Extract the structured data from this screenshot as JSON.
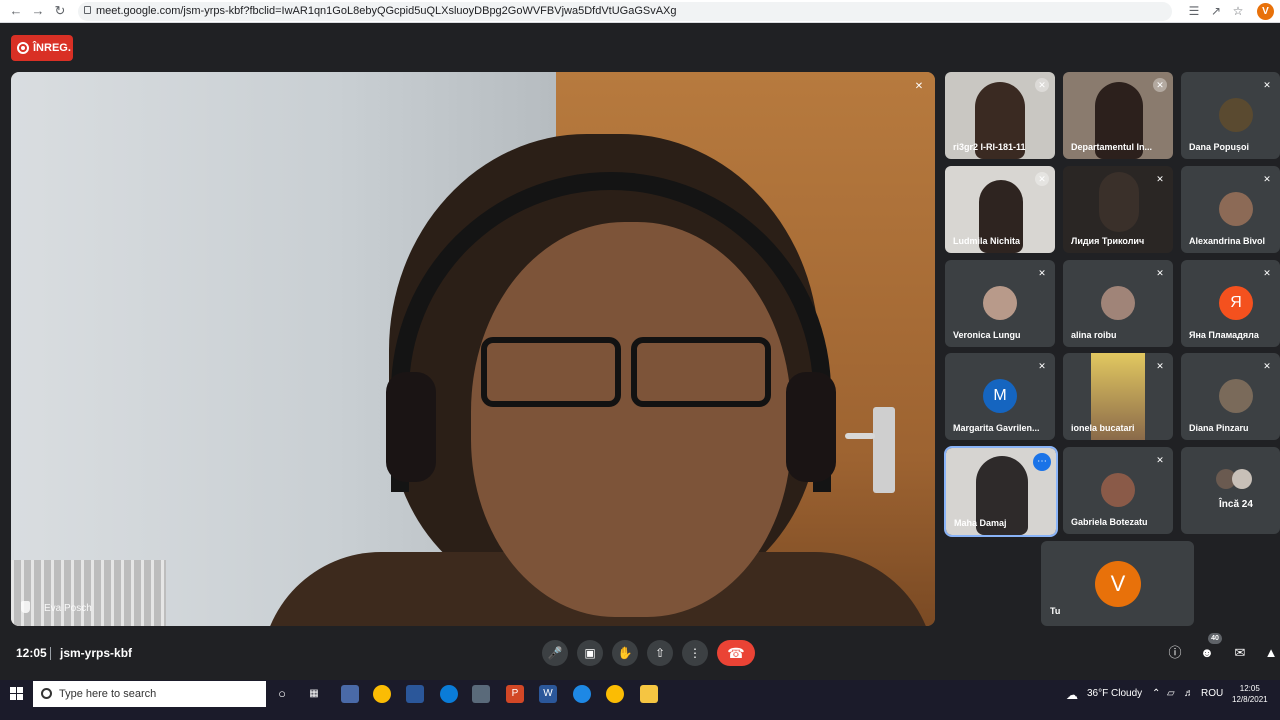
{
  "browser": {
    "url": "meet.google.com/jsm-yrps-kbf?fbclid=IwAR1qn1GoL8ebyQGcpid5uQLXsluoyDBpg2GoWVFBVjwa5DfdVtUGaGSvAXg",
    "profile_initial": "V"
  },
  "meeting": {
    "record_label": "ÎNREG.",
    "main_speaker": "Eva Posch",
    "time": "12:05",
    "code": "jsm-yrps-kbf",
    "participant_count": "40"
  },
  "tiles": [
    {
      "name": "ri3gr2 I-RI-181-11"
    },
    {
      "name": "Departamentul In..."
    },
    {
      "name": "Dana Popușoi"
    },
    {
      "name": "Ludmila Nichita"
    },
    {
      "name": "Лидия Триколич"
    },
    {
      "name": "Alexandrina Bivol"
    },
    {
      "name": "Veronica Lungu"
    },
    {
      "name": "alina roibu"
    },
    {
      "name": "Яна Пламадяла",
      "initial": "Я"
    },
    {
      "name": "Margarita Gavrilen...",
      "initial": "M"
    },
    {
      "name": "ionela bucatari"
    },
    {
      "name": "Diana Pinzaru"
    },
    {
      "name": "Maha Damaj"
    },
    {
      "name": "Gabriela Botezatu"
    },
    {
      "name": "Încă 24"
    }
  ],
  "self_tile": {
    "name": "Tu",
    "initial": "V"
  },
  "taskbar": {
    "search_placeholder": "Type here to search",
    "weather": "36°F  Cloudy",
    "language": "ROU",
    "clock_time": "12:05",
    "clock_date": "12/8/2021"
  }
}
